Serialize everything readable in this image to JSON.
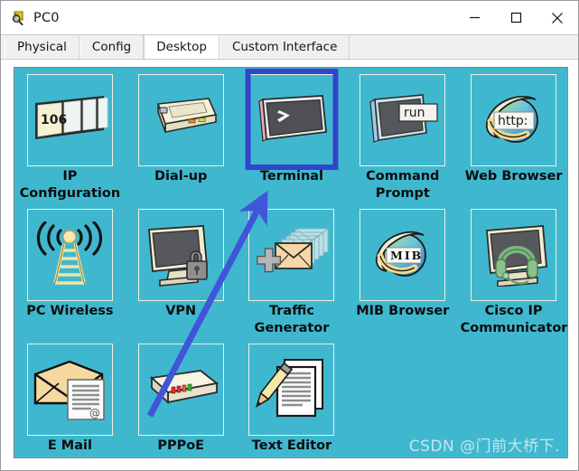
{
  "window": {
    "title": "PC0",
    "app_icon": "packet-tracer-icon",
    "controls": [
      {
        "name": "minimize-button",
        "glyph": "minimize-icon"
      },
      {
        "name": "maximize-button",
        "glyph": "maximize-icon"
      },
      {
        "name": "close-button",
        "glyph": "close-icon"
      }
    ]
  },
  "tabs": [
    {
      "label": "Physical",
      "selected": false
    },
    {
      "label": "Config",
      "selected": false
    },
    {
      "label": "Desktop",
      "selected": true
    },
    {
      "label": "Custom Interface",
      "selected": false
    }
  ],
  "desktop": {
    "background_color": "#3fb8cf",
    "selection_color": "#3344cc",
    "selected_item": "Terminal",
    "items": [
      {
        "label": "IP Configuration",
        "icon": "ip-configuration-icon",
        "selected": false
      },
      {
        "label": "Dial-up",
        "icon": "dial-up-modem-icon",
        "selected": false
      },
      {
        "label": "Terminal",
        "icon": "terminal-icon",
        "selected": true
      },
      {
        "label": "Command Prompt",
        "icon": "command-prompt-icon",
        "selected": false
      },
      {
        "label": "Web Browser",
        "icon": "web-browser-icon",
        "selected": false
      },
      {
        "label": "PC Wireless",
        "icon": "pc-wireless-antenna-icon",
        "selected": false
      },
      {
        "label": "VPN",
        "icon": "vpn-lock-icon",
        "selected": false
      },
      {
        "label": "Traffic Generator",
        "icon": "traffic-generator-icon",
        "selected": false
      },
      {
        "label": "MIB Browser",
        "icon": "mib-browser-icon",
        "selected": false
      },
      {
        "label": "Cisco IP Communicator",
        "icon": "ip-communicator-icon",
        "selected": false
      },
      {
        "label": "E Mail",
        "icon": "email-icon",
        "selected": false
      },
      {
        "label": "PPPoE",
        "icon": "pppoe-device-icon",
        "selected": false
      },
      {
        "label": "Text Editor",
        "icon": "text-editor-icon",
        "selected": false
      }
    ],
    "icon_text": {
      "ip_configuration_number": "106",
      "command_prompt_label": "run",
      "web_browser_label": "http:",
      "mib_browser_label": "MIB",
      "terminal_prompt": ">"
    },
    "annotation": {
      "type": "arrow",
      "color": "#4055d8",
      "points_to": "Terminal"
    }
  },
  "watermark": {
    "text": "CSDN @门前大桥下."
  }
}
